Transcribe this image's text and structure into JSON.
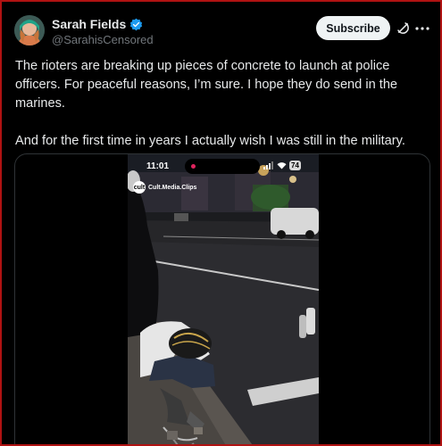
{
  "author": {
    "display_name": "Sarah Fields",
    "handle": "@SarahisCensored",
    "verified": true
  },
  "header": {
    "subscribe_label": "Subscribe"
  },
  "tweet": {
    "paragraph_1": "The rioters are breaking up pieces of concrete to launch at police officers. For peaceful reasons, I’m sure. I hope they do send in the marines.",
    "paragraph_2": "And for the first time in years I actually wish I was still in the military."
  },
  "video": {
    "phone_status_time": "11:01",
    "battery_level": "74",
    "watermark_text": "Cult.Media.Clips",
    "watermark_logo_text": "cult"
  },
  "colors": {
    "accent_blue": "#1d9bf0",
    "frame_red": "#b01212",
    "subscribe_bg": "#eff3f4",
    "secondary_text": "#71767b"
  },
  "icons": [
    "verified-badge-icon",
    "grok-icon",
    "more-options-icon"
  ]
}
